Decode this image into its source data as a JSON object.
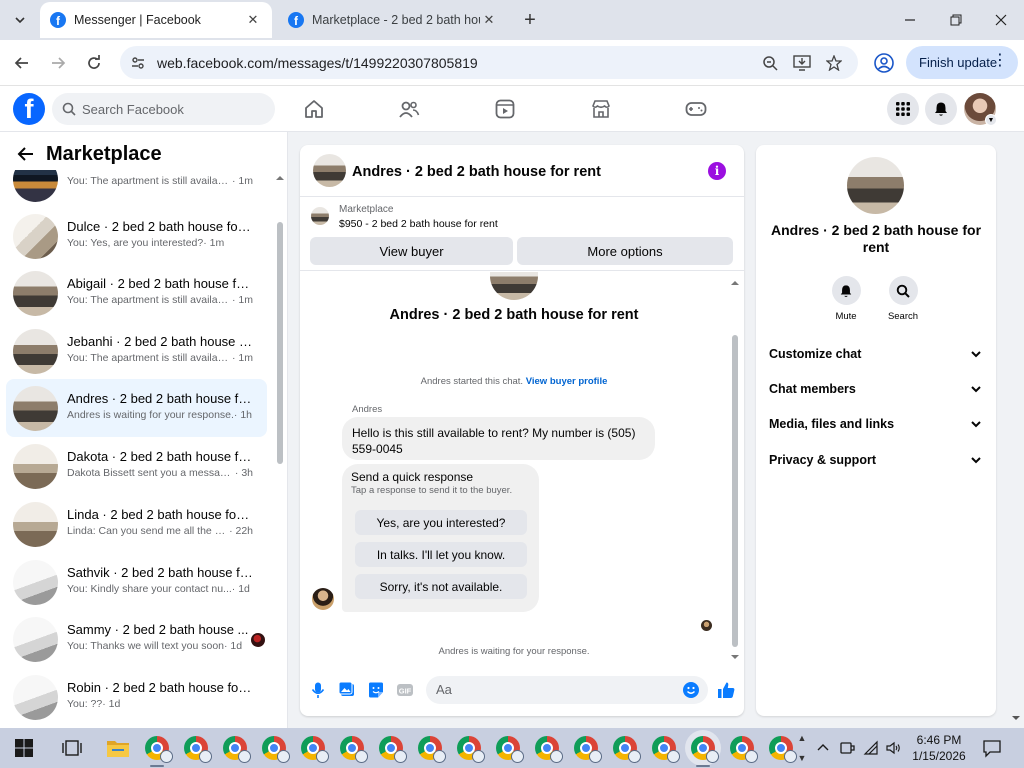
{
  "browser": {
    "tabs": [
      {
        "title": "Messenger | Facebook",
        "active": true
      },
      {
        "title": "Marketplace - 2 bed 2 bath hou",
        "active": false
      }
    ],
    "url": "web.facebook.com/messages/t/1499220307805819",
    "finish_update_label": "Finish update"
  },
  "fb_nav": {
    "search_placeholder": "Search Facebook",
    "logo_letter": "f"
  },
  "sidebar": {
    "title": "Marketplace",
    "conversations": [
      {
        "name": "",
        "preview": "You: The apartment is still availabl...",
        "time": "· 1m",
        "thumb": "room-e"
      },
      {
        "name": "Dulce · 2 bed 2 bath house for r...",
        "preview": "You: Yes, are you interested?",
        "time": " · 1m",
        "thumb": "room-b"
      },
      {
        "name": "Abigail · 2 bed 2 bath house for...",
        "preview": "You: The apartment is still availabl...",
        "time": " · 1m",
        "thumb": "room-a"
      },
      {
        "name": "Jebanhi · 2 bed 2 bath house fo...",
        "preview": "You: The apartment is still availabl...",
        "time": " · 1m",
        "thumb": "room-a"
      },
      {
        "name": "Andres · 2 bed 2 bath house for...",
        "preview": "Andres is waiting for your response.",
        "time": " · 1h",
        "thumb": "room-a",
        "selected": true
      },
      {
        "name": "Dakota · 2 bed 2 bath house for...",
        "preview": "Dakota Bissett sent you a message...",
        "time": " · 3h",
        "thumb": "room-c"
      },
      {
        "name": "Linda · 2 bed 2 bath house for r...",
        "preview": "Linda: Can you send me all the de...",
        "time": " · 22h",
        "thumb": "room-c"
      },
      {
        "name": "Sathvik · 2 bed 2 bath house for...",
        "preview": "You: Kindly share your contact nu...",
        "time": " · 1d",
        "thumb": "room-d"
      },
      {
        "name": "Sammy · 2 bed 2 bath house ...",
        "preview": "You: Thanks we will text you soon",
        "time": " · 1d",
        "thumb": "room-d"
      },
      {
        "name": "Robin · 2 bed 2 bath house for r...",
        "preview": "You: ??",
        "time": " · 1d",
        "thumb": "room-d"
      }
    ]
  },
  "chat": {
    "header_title": "Andres · 2 bed 2 bath house for rent",
    "listing_source": "Marketplace",
    "listing_price_title": "$950 - 2 bed 2 bath house for rent",
    "view_buyer_label": "View buyer",
    "more_options_label": "More options",
    "body_title": "Andres · 2 bed 2 bath house for rent",
    "started_text": "Andres started this chat.",
    "view_buyer_profile_label": "View buyer profile",
    "sender_name": "Andres",
    "message_text": "Hello is this still available to rent? My number is (505) 559-0045",
    "quick_response": {
      "title": "Send a quick response",
      "subtitle": "Tap a response to send it to the buyer.",
      "options": [
        "Yes, are you interested?",
        "In talks. I'll let you know.",
        "Sorry, it's not available."
      ]
    },
    "waiting_text": "Andres is waiting for your response.",
    "composer_placeholder": "Aa"
  },
  "info_panel": {
    "title": "Andres · 2 bed 2 bath house for rent",
    "actions": [
      {
        "label": "Mute",
        "icon": "bell-icon"
      },
      {
        "label": "Search",
        "icon": "search-icon"
      }
    ],
    "sections": [
      "Customize chat",
      "Chat members",
      "Media, files and links",
      "Privacy & support"
    ]
  },
  "taskbar": {
    "time": "6:46 PM",
    "date": "1/15/2026"
  },
  "colors": {
    "fb_blue": "#0866ff",
    "messenger_blue": "#0a7cff",
    "info_purple": "#9b0fe0",
    "selected_row": "#ebf5ff"
  }
}
